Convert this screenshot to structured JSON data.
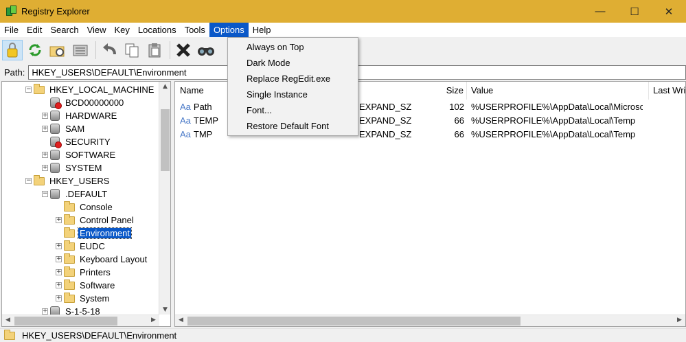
{
  "window": {
    "title": "Registry Explorer",
    "minimize": "—",
    "maximize": "☐",
    "close": "✕"
  },
  "menu": [
    "File",
    "Edit",
    "Search",
    "View",
    "Key",
    "Locations",
    "Tools",
    "Options",
    "Help"
  ],
  "toolbar_icons": [
    "lock-icon",
    "refresh-icon",
    "open-hive-icon",
    "hive-list-icon",
    "undo-icon",
    "copy-icon",
    "paste-icon",
    "delete-icon",
    "find-icon"
  ],
  "path": {
    "label": "Path:",
    "value": "HKEY_USERS\\DEFAULT\\Environment"
  },
  "tree": [
    {
      "label": "HKEY_LOCAL_MACHINE",
      "type": "folder",
      "expander": "−"
    },
    {
      "label": "BCD00000000",
      "type": "hive-bad",
      "expander": ""
    },
    {
      "label": "HARDWARE",
      "type": "hive",
      "expander": "+"
    },
    {
      "label": "SAM",
      "type": "hive",
      "expander": "+"
    },
    {
      "label": "SECURITY",
      "type": "hive-bad",
      "expander": ""
    },
    {
      "label": "SOFTWARE",
      "type": "hive",
      "expander": "+"
    },
    {
      "label": "SYSTEM",
      "type": "hive",
      "expander": "+"
    },
    {
      "label": "HKEY_USERS",
      "type": "folder",
      "expander": "−"
    },
    {
      "label": ".DEFAULT",
      "type": "hive",
      "expander": "−"
    },
    {
      "label": "Console",
      "type": "folder",
      "expander": ""
    },
    {
      "label": "Control Panel",
      "type": "folder",
      "expander": "+"
    },
    {
      "label": "Environment",
      "type": "folder",
      "expander": "",
      "selected": true
    },
    {
      "label": "EUDC",
      "type": "folder",
      "expander": "+"
    },
    {
      "label": "Keyboard Layout",
      "type": "folder",
      "expander": "+"
    },
    {
      "label": "Printers",
      "type": "folder",
      "expander": "+"
    },
    {
      "label": "Software",
      "type": "folder",
      "expander": "+"
    },
    {
      "label": "System",
      "type": "folder",
      "expander": "+"
    },
    {
      "label": "S-1-5-18",
      "type": "hive",
      "expander": "+"
    }
  ],
  "list": {
    "columns": {
      "name": "Name",
      "size": "Size",
      "value": "Value",
      "last_write": "Last Writ"
    },
    "rows": [
      {
        "name": "Path",
        "type": "EXPAND_SZ",
        "size": "102",
        "value": "%USERPROFILE%\\AppData\\Local\\Microsoft\\..."
      },
      {
        "name": "TEMP",
        "type": "EXPAND_SZ",
        "size": "66",
        "value": "%USERPROFILE%\\AppData\\Local\\Temp"
      },
      {
        "name": "TMP",
        "type": "EXPAND_SZ",
        "size": "66",
        "value": "%USERPROFILE%\\AppData\\Local\\Temp"
      }
    ]
  },
  "options_menu": [
    "Always on Top",
    "Dark Mode",
    "Replace RegEdit.exe",
    "Single Instance",
    "Font...",
    "Restore Default Font"
  ],
  "status": {
    "text": "HKEY_USERS\\DEFAULT\\Environment"
  }
}
